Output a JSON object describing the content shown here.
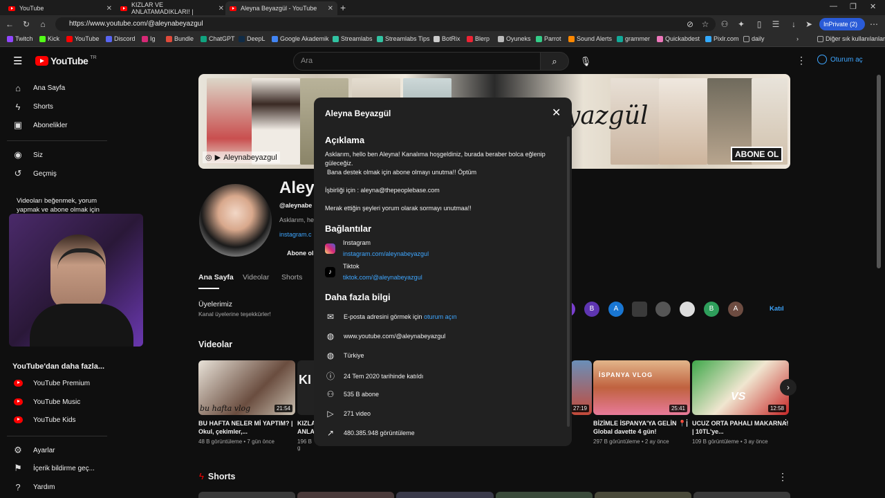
{
  "browser": {
    "tabs": [
      {
        "label": "YouTube"
      },
      {
        "label": "KIZLAR VE ANLATAMADIKLARI! |"
      },
      {
        "label": "Aleyna Beyazgül - YouTube"
      }
    ],
    "url": "https://www.youtube.com/@aleynabeyazgul",
    "inprivate": "InPrivate (2)",
    "bookmarks": [
      "Twitch",
      "Kick",
      "YouTube",
      "Discord",
      "Ig",
      "Bundle",
      "ChatGPT",
      "DeepL",
      "Google Akademik",
      "Streamlabs",
      "Streamlabs Tips",
      "BotRix",
      "Blerp",
      "Oyuneks",
      "Parrot",
      "Sound Alerts",
      "grammer",
      "Quickabdest",
      "Pixlr.com",
      "daily"
    ],
    "other_bookmarks": "Diğer sık kullanılanlar"
  },
  "youtube": {
    "logo": "YouTube",
    "region": "TR",
    "search_placeholder": "Ara",
    "signin": "Oturum aç"
  },
  "sidebar": {
    "items": [
      "Ana Sayfa",
      "Shorts",
      "Abonelikler"
    ],
    "you": [
      "Siz",
      "Geçmiş"
    ],
    "signin_prompt_1": "Videoları beğenmek, yorum",
    "signin_prompt_2": "yapmak ve abone olmak için",
    "more_title": "YouTube'dan daha fazla...",
    "more": [
      "YouTube Premium",
      "YouTube Music",
      "YouTube Kids"
    ],
    "bottom": [
      "Ayarlar",
      "İçerik bildirme geç...",
      "Yardım"
    ]
  },
  "channel": {
    "banner_handle": "Aleynabeyazgul",
    "banner_name": "yazgül",
    "banner_subscribe": "ABONE OL",
    "name": "Aleyn",
    "handle": "@aleynabe",
    "desc": "Asklarım, he",
    "link": "instagram.c",
    "subscribe": "Abone ol",
    "tabs": [
      "Ana Sayfa",
      "Videolar",
      "Shorts"
    ],
    "members_title": "Üyelerimiz",
    "members_sub": "Kanal üyelerine teşekkürler!",
    "members_initials": [
      "B",
      "A",
      "B",
      "A"
    ],
    "join": "Katıl",
    "videos_title": "Videolar",
    "shorts_title": "Shorts"
  },
  "videos": [
    {
      "title": "BU HAFTA NELER Mİ YAPTIM? | Okul, çekimler,...",
      "meta": "48 B görüntüleme • 7 gün önce",
      "duration": "21:54",
      "overlay": "bu hafta vlog"
    },
    {
      "title": "KIZLA ANLA",
      "meta": "196 B g",
      "duration": "",
      "overlay": "KI"
    },
    {
      "title": "",
      "meta": "",
      "duration": "27:19",
      "overlay": ""
    },
    {
      "title": "BİZİMLE İSPANYA'YA GELİN 📍| Global davette 4 gün!",
      "meta": "297 B görüntüleme • 2 ay önce",
      "duration": "25:41",
      "overlay": "İSPANYA VLOG"
    },
    {
      "title": "UCUZ ORTA PAHALI MAKARNA! | 10TL'ye...",
      "meta": "109 B görüntüleme • 3 ay önce",
      "duration": "12:58",
      "overlay": "VS"
    }
  ],
  "modal": {
    "title": "Aleyna Beyazgül",
    "about_heading": "Açıklama",
    "about_line1": "Asklarım, hello ben Aleyna! Kanalıma hoşgeldiniz, burada beraber bolca eğlenip",
    "about_line2": "güleceğiz.",
    "about_line3": "Bana destek olmak için abone olmayı unutma!! Öptüm",
    "about_line4": "İşbirliği için : aleyna@thepeoplebase.com",
    "about_line5": "Merak ettiğin şeyleri yorum olarak sormayı unutmaa!!",
    "links_heading": "Bağlantılar",
    "links": [
      {
        "name": "Instagram",
        "url": "instagram.com/aleynabeyazgul"
      },
      {
        "name": "Tiktok",
        "url": "tiktok.com/@aleynabeyazgul"
      }
    ],
    "more_heading": "Daha fazla bilgi",
    "email_text": "E-posta adresini görmek için",
    "email_link": "oturum açın",
    "channel_url": "www.youtube.com/@aleynabeyazgul",
    "country": "Türkiye",
    "joined": "24 Tem 2020 tarihinde katıldı",
    "subscribers": "535 B abone",
    "videos": "271 video",
    "views": "480.385.948 görüntüleme"
  }
}
